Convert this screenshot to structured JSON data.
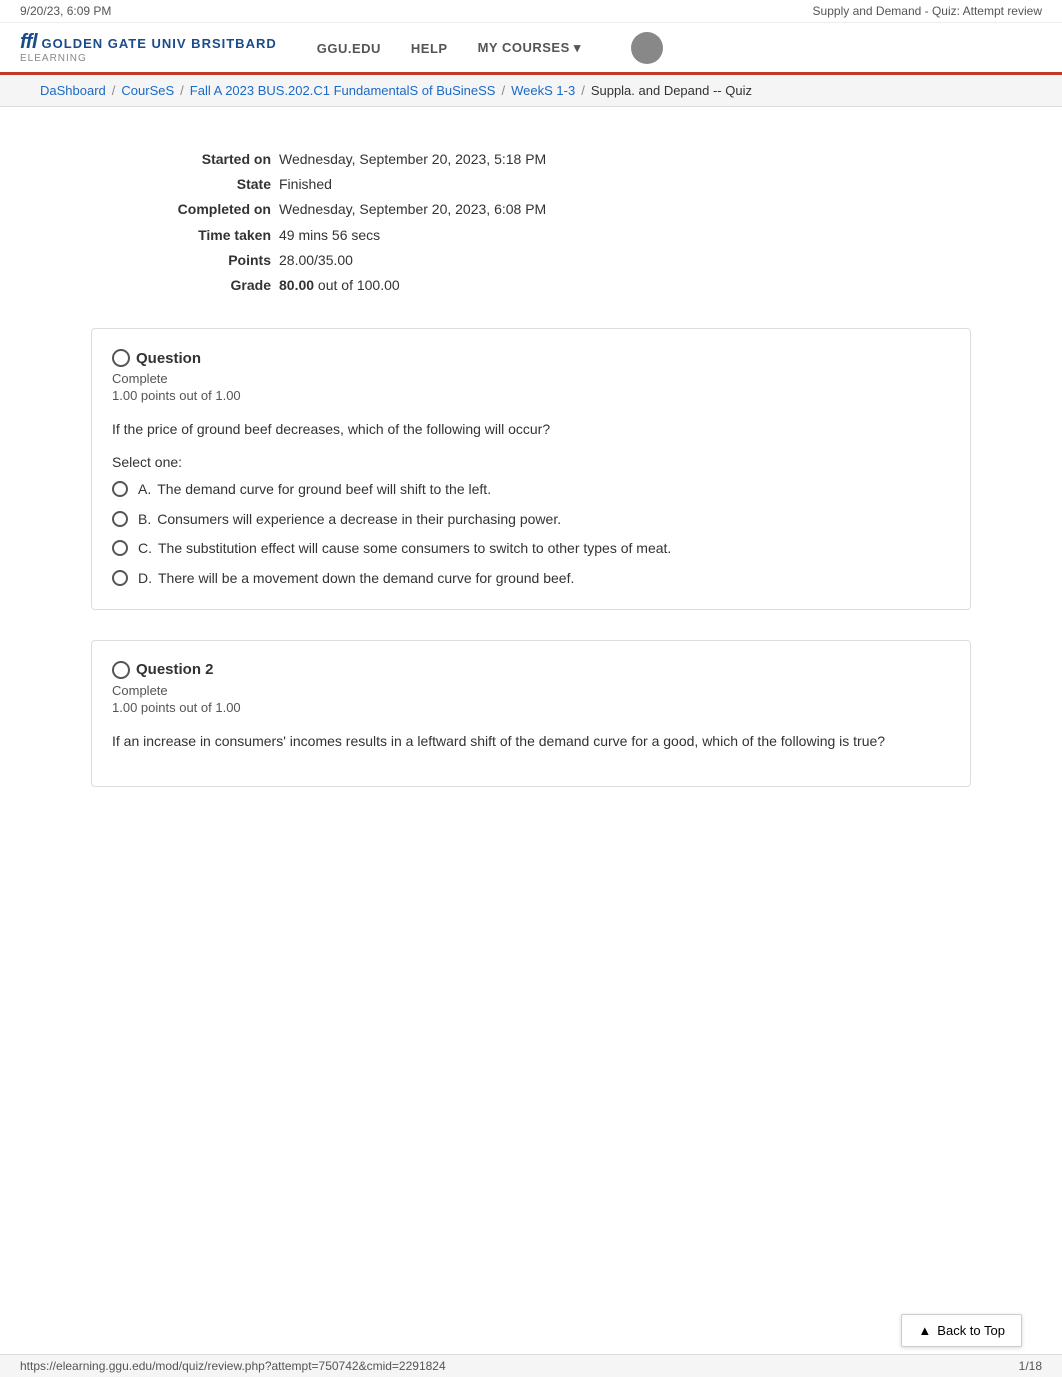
{
  "topbar": {
    "datetime": "9/20/23, 6:09 PM",
    "page_title": "Supply and Demand - Quiz: Attempt review"
  },
  "header": {
    "logo_top": "ffl GOLDEN GATE UNIV BRSITBARD",
    "logo_sub": "eLEARNING",
    "nav": [
      {
        "label": "GGU.EDU"
      },
      {
        "label": "HELP"
      },
      {
        "label": "MY COURSES ▾"
      }
    ]
  },
  "breadcrumb": {
    "items": [
      {
        "label": "DaShboard",
        "href": "#"
      },
      {
        "label": "CourSeS",
        "href": "#"
      },
      {
        "label": "Fall A 2023 BUS.202.C1 FundamentalS of BuSineSS",
        "href": "#"
      },
      {
        "label": "WeekS 1-3",
        "href": "#"
      },
      {
        "label": "Suppla. and Depand -- Quiz",
        "href": "#"
      }
    ],
    "separator": "/"
  },
  "summary": {
    "rows": [
      {
        "label": "Started on",
        "value": "Wednesday, September 20, 2023, 5:18 PM"
      },
      {
        "label": "State",
        "value": "Finished"
      },
      {
        "label": "Completed on",
        "value": "Wednesday, September 20, 2023, 6:08 PM"
      },
      {
        "label": "Time taken",
        "value": "49 mins 56 secs"
      },
      {
        "label": "Points",
        "value": "28.00/35.00"
      },
      {
        "label": "Grade",
        "value": "80.00 out of 100.00"
      }
    ]
  },
  "questions": [
    {
      "id": "q1",
      "number": "uestion",
      "full_title": "Question",
      "status": "Complete",
      "points": "1.00 points out of 1.00",
      "text": "If the price of ground beef decreases, which of the following will occur?",
      "select_label": "Select one:",
      "options": [
        {
          "letter": "A.",
          "text": "The demand curve for ground beef will shift to the left."
        },
        {
          "letter": "B.",
          "text": "Consumers will experience a decrease in their purchasing power."
        },
        {
          "letter": "C.",
          "text": "The substitution effect will cause some consumers to switch to other types of meat."
        },
        {
          "letter": "D.",
          "text": "There will be a movement down the demand curve for ground beef."
        }
      ]
    },
    {
      "id": "q2",
      "number": "uestion 2",
      "full_title": "Question 2",
      "status": "Complete",
      "points": "1.00 points out of 1.00",
      "text": "If an increase in consumers' incomes results in a leftward shift of the demand curve for a good, which of the following is true?",
      "select_label": "",
      "options": []
    }
  ],
  "back_to_top": {
    "label": "Back to Top",
    "icon": "▲"
  },
  "footer": {
    "url": "https://elearning.ggu.edu/mod/quiz/review.php?attempt=750742&cmid=2291824",
    "page": "1/18"
  }
}
